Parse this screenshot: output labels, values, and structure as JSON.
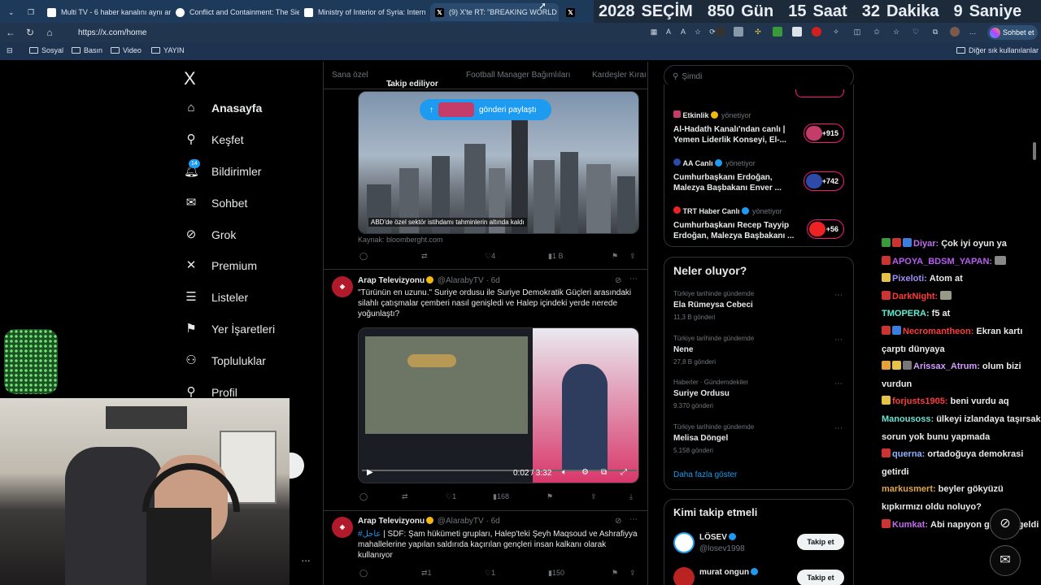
{
  "browser": {
    "tabs": [
      {
        "label": "Multi TV - 6 haber kanalını aynı an"
      },
      {
        "label": "Conflict and Containment: The Sie"
      },
      {
        "label": "Ministry of Interior of Syria: Intern"
      },
      {
        "label": "(9) X'te RT: \"BREAKING WORLD E"
      },
      {
        "label": ""
      }
    ],
    "url": "https://x.com/home",
    "chat_button": "Sohbet et",
    "bookmarks": [
      "Sosyal",
      "Basın",
      "Video",
      "YAYIN"
    ],
    "other_bookmarks": "Diğer sık kullanılanlar"
  },
  "countdown": {
    "year": "2028",
    "label": "SEÇİM",
    "days": "850",
    "days_label": "Gün",
    "hours": "15",
    "hours_label": "Saat",
    "minutes": "32",
    "minutes_label": "Dakika",
    "seconds": "9",
    "seconds_label": "Saniye"
  },
  "nav": {
    "logo": "X",
    "items": [
      {
        "label": "Anasayfa",
        "icon": "home-icon"
      },
      {
        "label": "Keşfet",
        "icon": "search-icon"
      },
      {
        "label": "Bildirimler",
        "icon": "bell-icon",
        "badge": "14"
      },
      {
        "label": "Sohbet",
        "icon": "mail-icon"
      },
      {
        "label": "Grok",
        "icon": "grok-icon"
      },
      {
        "label": "Premium",
        "icon": "x-icon"
      },
      {
        "label": "Listeler",
        "icon": "list-icon"
      },
      {
        "label": "Yer İşaretleri",
        "icon": "bookmark-icon"
      },
      {
        "label": "Topluluklar",
        "icon": "people-icon"
      },
      {
        "label": "Profil",
        "icon": "person-icon"
      }
    ]
  },
  "feed": {
    "tabs": [
      "Sana özel",
      "Takip ediliyor",
      "Football Manager Bağımlıları",
      "Kardeşler Kıraı"
    ],
    "share_pill": "gönderi paylaştı",
    "post1": {
      "caption": "ABD'de özel sektör istihdamı tahminlerin altında kaldı",
      "source": "Kaynak: bloomberght.com",
      "likes": "4",
      "views": "1 B"
    },
    "post2": {
      "name": "Arap Televizyonu",
      "handle": "@AlarabyTV · 6d",
      "text": "\"Türünün en uzunu.\" Suriye ordusu ile Suriye Demokratik Güçleri arasındaki silahlı çatışmalar çemberi nasıl genişledi ve Halep içindeki yerde nerede yoğunlaştı?",
      "time": "0:02 / 3:32",
      "likes": "1",
      "views": "168"
    },
    "post3": {
      "name": "Arap Televizyonu",
      "handle": "@AlarabyTV · 6d",
      "hashtag": "#عاجل",
      "text": " | SDF: Şam hükümeti grupları, Halep'teki Şeyh Maqsoud ve Ashrafiyya mahallelerine yapılan saldırıda kaçırılan gençleri insan kalkanı olarak kullanıyor",
      "retweets": "1",
      "likes": "1",
      "views": "150"
    }
  },
  "right": {
    "search_placeholder": "Şimdi",
    "lives": [
      {
        "name": "Etkinlik",
        "role": "yönetiyor",
        "title": "Al-Hadath Kanalı'ndan canlı | Yemen Liderlik Konseyi, El-...",
        "count": "+915"
      },
      {
        "name": "AA Canlı",
        "role": "yönetiyor",
        "title": "Cumhurbaşkanı Erdoğan, Malezya Başbakanı Enver ...",
        "count": "+742"
      },
      {
        "name": "TRT Haber Canlı",
        "role": "yönetiyor",
        "title": "Cumhurbaşkanı Recep Tayyip Erdoğan, Malezya Başbakanı ...",
        "count": "+56"
      }
    ],
    "trends_title": "Neler oluyor?",
    "trends": [
      {
        "cat": "Türkiye tarihinde gündemde",
        "name": "Ela Rümeysa Cebeci",
        "count": "11,3 B gönderi"
      },
      {
        "cat": "Türkiye tarihinde gündemde",
        "name": "Nene",
        "count": "27,8 B gönderi"
      },
      {
        "cat": "Haberler · Gündemdekiler",
        "name": "Suriye Ordusu",
        "count": "9.370 gönderi"
      },
      {
        "cat": "Türkiye tarihinde gündemde",
        "name": "Melisa Döngel",
        "count": "5.158 gönderi"
      }
    ],
    "show_more": "Daha fazla göster",
    "who_title": "Kimi takip etmeli",
    "who": [
      {
        "name": "LÖSEV",
        "handle": "@losev1998",
        "button": "Takip et"
      },
      {
        "name": "murat ongun",
        "handle": "",
        "button": "Takip et"
      }
    ]
  },
  "chat": [
    {
      "user": "Diyar:",
      "msg": "Çok iyi oyun ya",
      "color": "#c36cf0"
    },
    {
      "user": "APOYA_BDSM_YAPAN:",
      "msg": "",
      "color": "#b95cf5"
    },
    {
      "user": "Pixeloti:",
      "msg": "Atom at",
      "color": "#a08cf5"
    },
    {
      "user": "DarkNight:",
      "msg": "",
      "color": "#ff3b3b"
    },
    {
      "user": "TMOPERA:",
      "msg": "f5 at",
      "color": "#5cf0d0"
    },
    {
      "user": "Necromantheon:",
      "msg": "Ekran kartı çarptı dünyaya",
      "color": "#ff3b3b"
    },
    {
      "user": "Arissax_Atrum:",
      "msg": "olum bizi vurdun",
      "color": "#d59cff"
    },
    {
      "user": "forjusts1905:",
      "msg": "beni vurdu aq",
      "color": "#ff3b3b"
    },
    {
      "user": "Manousoss:",
      "msg": "ülkeyi izlandaya taşırsak sorun yok bunu yapmada",
      "color": "#69e4d2"
    },
    {
      "user": "querna:",
      "msg": "ortadoğuya demokrasi getirdi",
      "color": "#8ab4ff"
    },
    {
      "user": "markusmert:",
      "msg": "beyler gökyüzü kıpkırmızı oldu noluyo?",
      "color": "#e3a64a"
    },
    {
      "user": "Kumkat:",
      "msg": "Abi napıyon gafama geldi",
      "color": "#c36cf0"
    }
  ]
}
